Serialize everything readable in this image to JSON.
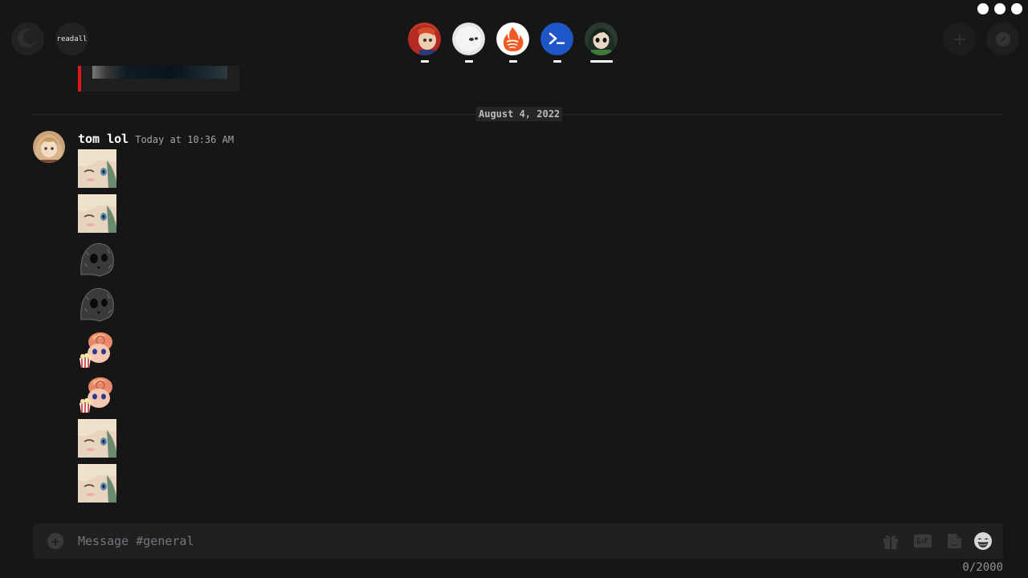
{
  "window": {
    "controls": [
      "control-1",
      "control-2",
      "control-3"
    ]
  },
  "topbar": {
    "readall_label": "readall",
    "servers": [
      {
        "name": "server-1",
        "icon": "red-anime-avatar-icon"
      },
      {
        "name": "server-2",
        "icon": "white-ghost-avatar-icon"
      },
      {
        "name": "server-3",
        "icon": "fire-icon"
      },
      {
        "name": "server-4",
        "icon": "terminal-icon"
      },
      {
        "name": "server-5",
        "icon": "frog-girl-avatar-icon"
      }
    ]
  },
  "chat": {
    "date_divider": "August 4, 2022",
    "message": {
      "author": "tom lol",
      "timestamp": "Today at 10:36 AM",
      "emojis": [
        "wink-girl",
        "wink-girl",
        "skull",
        "skull",
        "popcorn-guy",
        "popcorn-guy",
        "wink-girl",
        "wink-girl"
      ]
    }
  },
  "composer": {
    "placeholder": "Message #general",
    "char_count": "0/2000"
  },
  "colors": {
    "accent_red": "#e01818",
    "terminal_blue": "#1e56c8",
    "fire_orange": "#f15a24"
  }
}
